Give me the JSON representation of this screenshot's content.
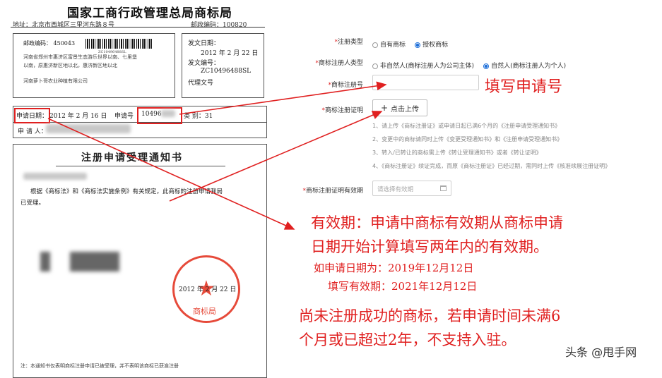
{
  "doc": {
    "title": "国家工商行政管理总局商标局",
    "address": "地址：北京市西城区三里河东路８号",
    "postcode": "邮政编码：100820",
    "mail": {
      "code": "邮政编码： 450043",
      "barcode_text": "ZC10496488SL",
      "lines": [
        "河南省郑州市惠济区富景生态游乐世界以南、七里堡",
        "以南，原惠济新区地以北，惠济新区地以北"
      ],
      "company": "河南萝卜哥农业种植有限公司"
    },
    "dispatch": {
      "date_label": "发文日期：",
      "date_value": "2012 年 2 月 22 日",
      "no_label": "发文编号：",
      "no_value": "ZC10496488SL",
      "agent": "代理文号"
    },
    "application": {
      "date_label": "申请日期：",
      "date_value": "2012 年 2 月 16 日",
      "no_label": "申请号",
      "no_value": "10496",
      "class_label": "类  别：31",
      "applicant_label": "申 请 人："
    },
    "notice": {
      "heading": "注册申请受理通知书",
      "body_line1": "根据《商标法》和《商标法实施条例》有关规定，此商标的注册申请我局",
      "body_line2": "已受理。",
      "seal_date": "2012 年 2 月 22 日",
      "seal_name": "商标局",
      "seal_star": "★",
      "footer": "注：本通知书仅表明商标注册申请已被受理，并不表明该商标已获准注册"
    }
  },
  "form": {
    "reg_type": {
      "label": "注册类型",
      "options": [
        "自有商标",
        "授权商标"
      ],
      "selected": 1
    },
    "registrant_type": {
      "label": "商标注册人类型",
      "options": [
        "非自然人(商标注册人为公司主体)",
        "自然人(商标注册人为个人)"
      ],
      "selected": 1
    },
    "reg_no": {
      "label": "商标注册号",
      "value": ""
    },
    "reg_cert": {
      "label": "商标注册证明",
      "upload_label": "点击上传"
    },
    "notes": [
      "1、请上传《商标注册证》或申请日起已满6个月的《注册申请受理通知书》",
      "2、变更中的商标请同时上传《变更受理通知书》和《注册申请受理通知书》",
      "3、转入/已转让的商标需上传《转让受理通知书》或者《转让证明》",
      "4、《商标注册证》续证完成，而原《商标注册证》已经过期，需同时上传《核准续展注册证明》"
    ],
    "validity": {
      "label": "商标注册证明有效期",
      "placeholder": "请选择有效期"
    }
  },
  "annotations": {
    "fill_no": "填写申请号",
    "validity_line1": "有效期：申请中商标有效期从商标申请",
    "validity_line2": "日期开始计算填写两年内的有效期。",
    "example_line1": "如申请日期为：2019年12月12日",
    "example_line2": "填写有效期：2021年12月12日",
    "warn_line1": "尚未注册成功的商标，若申请时间未满6",
    "warn_line2": "个月或已超过2年，不支持入驻。"
  },
  "watermark": {
    "text": "头条 @甩手网"
  },
  "colors": {
    "annotation_red": "#e02020",
    "radio_blue": "#1e6fd9",
    "seal_red": "#e64a3a"
  },
  "icons": {
    "upload": "plus-icon",
    "date": "calendar-icon"
  }
}
